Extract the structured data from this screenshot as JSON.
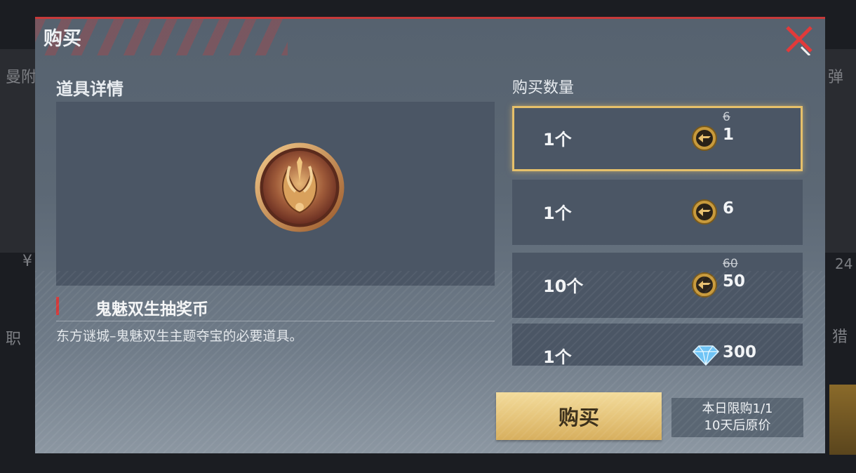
{
  "background": {
    "left_top_text": "曼附",
    "left_mid_text": "¥",
    "left_low_text": "职",
    "right_top_text": "弹",
    "right_mid_text": "24",
    "right_low_text": "猎"
  },
  "dialog": {
    "title": "购买",
    "close_icon": "close-x-icon",
    "accent_color": "#c73a3a"
  },
  "details": {
    "heading": "道具详情",
    "item_icon": "ghost-twin-token-icon",
    "item_name": "鬼魅双生抽奖币",
    "item_description": "东方谜城–鬼魅双生主题夺宝的必要道具。"
  },
  "purchase": {
    "heading": "购买数量",
    "options": [
      {
        "qty": "1个",
        "currency": "cf-coin-icon",
        "old_price": "6",
        "price": "1",
        "selected": true
      },
      {
        "qty": "1个",
        "currency": "cf-coin-icon",
        "old_price": "",
        "price": "6",
        "selected": false
      },
      {
        "qty": "10个",
        "currency": "cf-coin-icon",
        "old_price": "60",
        "price": "50",
        "selected": false
      },
      {
        "qty": "1个",
        "currency": "diamond-icon",
        "old_price": "",
        "price": "300",
        "selected": false
      }
    ],
    "buy_label": "购买",
    "limit_line1": "本日限购1/1",
    "limit_line2": "10天后原价",
    "button_color": "#e5c47a",
    "selected_border_color": "#e6c06a"
  }
}
